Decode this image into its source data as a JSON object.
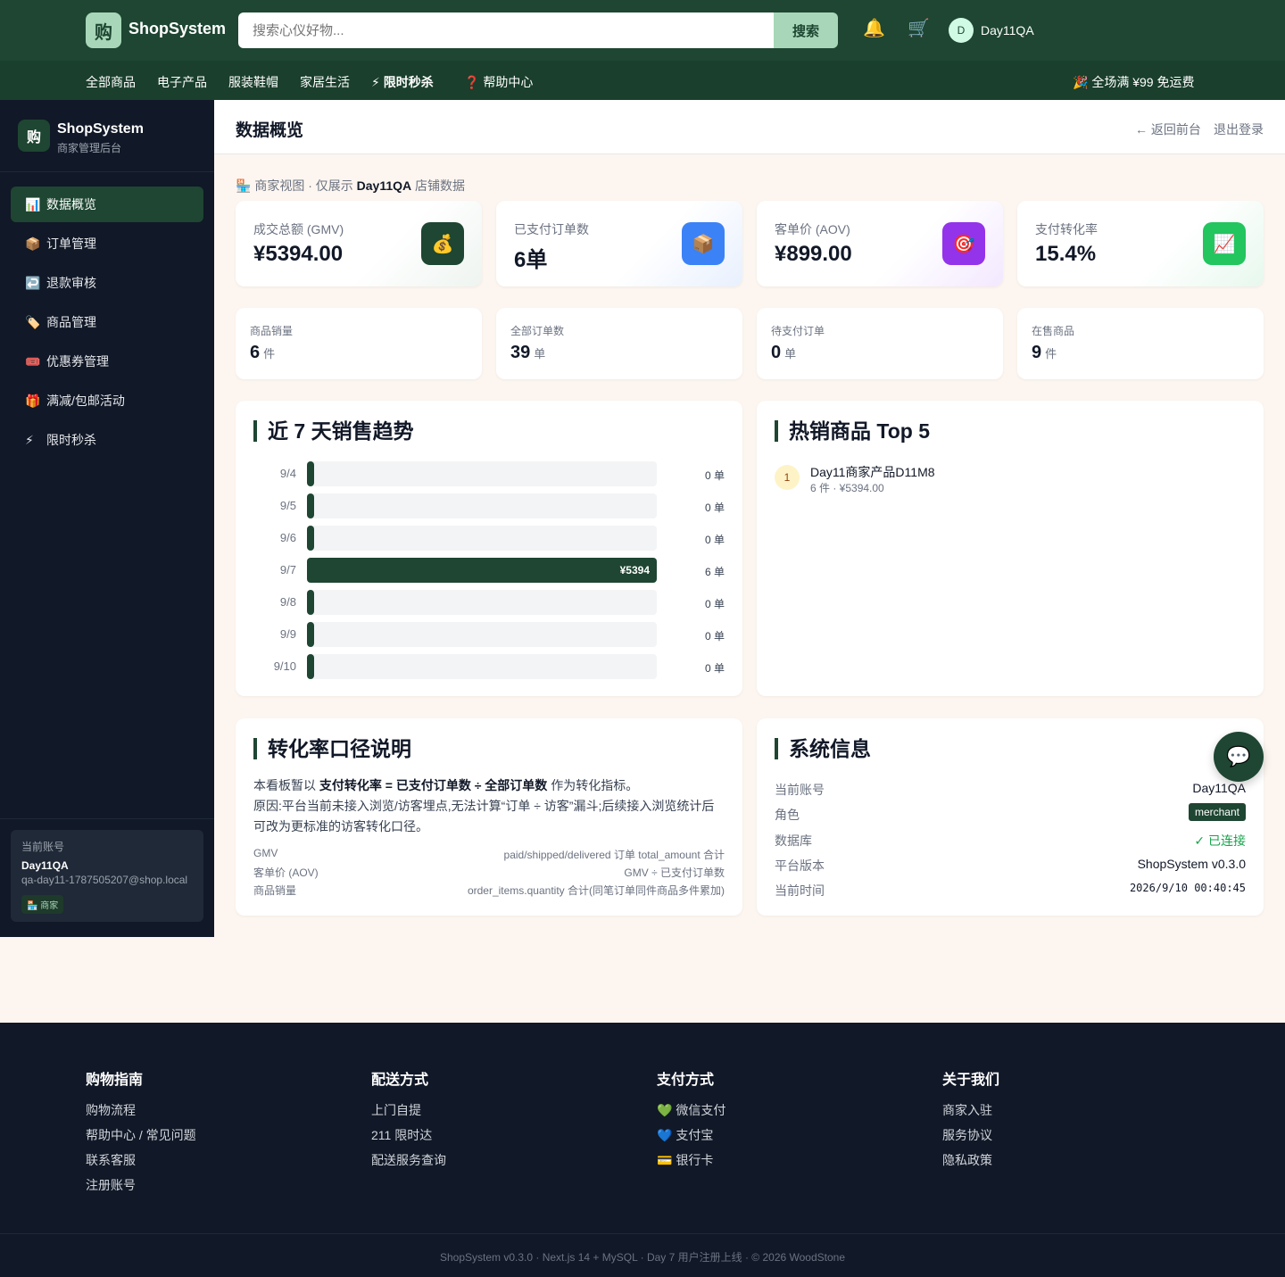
{
  "header": {
    "logo_char": "购",
    "brand": "ShopSystem",
    "search_placeholder": "搜索心仪好物...",
    "search_button": "搜索",
    "bell": "🔔",
    "cart": "🛒",
    "avatar_letter": "D",
    "user": "Day11QA"
  },
  "nav": {
    "items": [
      "全部商品",
      "电子产品",
      "服装鞋帽",
      "家居生活",
      "⚡ 限时秒杀",
      "❓ 帮助中心"
    ],
    "promo": "🎉 全场满 ¥99 免运费"
  },
  "sidebar": {
    "logo_char": "购",
    "title": "ShopSystem",
    "subtitle": "商家管理后台",
    "items": [
      {
        "icon": "📊",
        "label": "数据概览"
      },
      {
        "icon": "📦",
        "label": "订单管理"
      },
      {
        "icon": "↩️",
        "label": "退款审核"
      },
      {
        "icon": "🏷️",
        "label": "商品管理"
      },
      {
        "icon": "🎟️",
        "label": "优惠券管理"
      },
      {
        "icon": "🎁",
        "label": "满减/包邮活动"
      },
      {
        "icon": "⚡",
        "label": "限时秒杀"
      }
    ],
    "account": {
      "label": "当前账号",
      "name": "Day11QA",
      "email": "qa-day11-1787505207@shop.local",
      "role_badge": "🏪 商家"
    }
  },
  "main": {
    "title": "数据概览",
    "back_link": "← 返回前台",
    "logout": "退出登录",
    "scope_prefix": "🏪 商家视图 · 仅展示",
    "scope_store": "Day11QA",
    "scope_suffix": "店铺数据"
  },
  "kpis": [
    {
      "label": "成交总额 (GMV)",
      "value": "¥5394.00",
      "icon": "💰",
      "icon_bg": "#1e4632"
    },
    {
      "label": "已支付订单数",
      "value": "6单",
      "icon": "📦",
      "icon_bg": "#3b82f6"
    },
    {
      "label": "客单价 (AOV)",
      "value": "¥899.00",
      "icon": "🎯",
      "icon_bg": "#9333ea"
    },
    {
      "label": "支付转化率",
      "value": "15.4%",
      "icon": "📈",
      "icon_bg": "#22c55e"
    }
  ],
  "stats": [
    {
      "label": "商品销量",
      "value": "6",
      "unit": "件"
    },
    {
      "label": "全部订单数",
      "value": "39",
      "unit": "单"
    },
    {
      "label": "待支付订单",
      "value": "0",
      "unit": "单"
    },
    {
      "label": "在售商品",
      "value": "9",
      "unit": "件"
    }
  ],
  "trend": {
    "title": "近 7 天销售趋势",
    "rows": [
      {
        "date": "9/4",
        "amount": "",
        "count": "0 单",
        "fraction": 0
      },
      {
        "date": "9/5",
        "amount": "",
        "count": "0 单",
        "fraction": 0
      },
      {
        "date": "9/6",
        "amount": "",
        "count": "0 单",
        "fraction": 0
      },
      {
        "date": "9/7",
        "amount": "¥5394",
        "count": "6 单",
        "fraction": 1
      },
      {
        "date": "9/8",
        "amount": "",
        "count": "0 单",
        "fraction": 0
      },
      {
        "date": "9/9",
        "amount": "",
        "count": "0 单",
        "fraction": 0
      },
      {
        "date": "9/10",
        "amount": "",
        "count": "0 单",
        "fraction": 0
      }
    ]
  },
  "top_products": {
    "title": "热销商品 Top 5",
    "items": [
      {
        "rank": "1",
        "name": "Day11商家产品D11M8",
        "meta": "6 件 · ¥5394.00"
      }
    ]
  },
  "conversion": {
    "title": "转化率口径说明",
    "p1_pre": "本看板暂以 ",
    "p1_bold": "支付转化率 = 已支付订单数 ÷ 全部订单数",
    "p1_post": " 作为转化指标。",
    "p2": "原因:平台当前未接入浏览/访客埋点,无法计算“订单 ÷ 访客”漏斗;后续接入浏览统计后可改为更标准的访客转化口径。",
    "rows": [
      {
        "k": "GMV",
        "v": "paid/shipped/delivered 订单 total_amount 合计"
      },
      {
        "k": "客单价 (AOV)",
        "v": "GMV ÷ 已支付订单数"
      },
      {
        "k": "商品销量",
        "v": "order_items.quantity 合计(同笔订单同件商品多件累加)"
      }
    ]
  },
  "system": {
    "title": "系统信息",
    "account_label": "当前账号",
    "account": "Day11QA",
    "role_label": "角色",
    "role": "merchant",
    "db_label": "数据库",
    "db": "✓ 已连接",
    "version_label": "平台版本",
    "version": "ShopSystem v0.3.0",
    "time_label": "当前时间",
    "time": "2026/9/10 00:40:45"
  },
  "chat_icon": "💬",
  "footer": {
    "cols": [
      {
        "title": "购物指南",
        "links": [
          "购物流程",
          "帮助中心 / 常见问题",
          "联系客服",
          "注册账号"
        ]
      },
      {
        "title": "配送方式",
        "links": [
          "上门自提",
          "211 限时达",
          "配送服务查询"
        ]
      },
      {
        "title": "支付方式",
        "links": [
          "💚 微信支付",
          "💙 支付宝",
          "💳 银行卡"
        ]
      },
      {
        "title": "关于我们",
        "links": [
          "商家入驻",
          "服务协议",
          "隐私政策"
        ]
      }
    ],
    "copyright": "ShopSystem v0.3.0 · Next.js 14 + MySQL · Day 7 用户注册上线 · © 2026 WoodStone"
  }
}
